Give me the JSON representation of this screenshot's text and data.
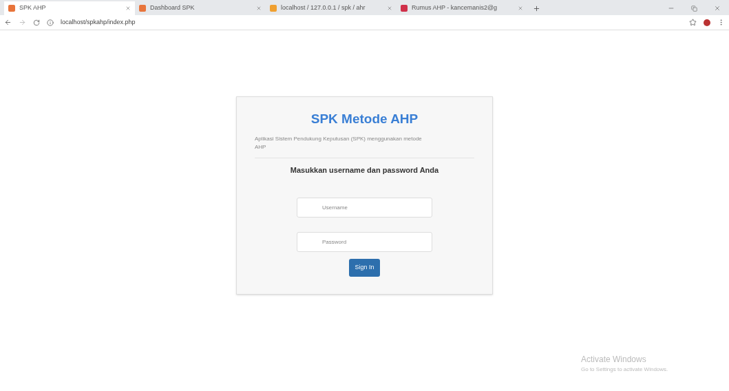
{
  "tabs": [
    {
      "title": "SPK AHP",
      "selected": true,
      "kind": "page"
    },
    {
      "title": "Dashboard SPK",
      "selected": false,
      "kind": "page"
    },
    {
      "title": "localhost / 127.0.0.1 / spk / ahr",
      "selected": false,
      "kind": "database"
    },
    {
      "title": "Rumus AHP - kancemanis2@g",
      "selected": false,
      "kind": "mail"
    }
  ],
  "address_bar": {
    "url": "localhost/spkahp/index.php"
  },
  "login": {
    "title": "SPK Metode AHP",
    "description": "Aplikasi Sistem Pendukung Keputusan (SPK) menggunakan metode AHP",
    "prompt": "Masukkan username dan password Anda",
    "username_placeholder": "Username",
    "password_placeholder": "Password",
    "button": "Sign In"
  },
  "activation_notice": {
    "title": "Activate Windows",
    "subtitle": "Go to Settings to activate Windows."
  }
}
